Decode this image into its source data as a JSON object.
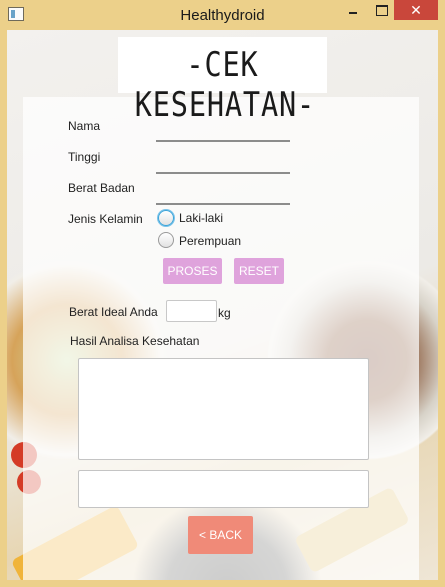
{
  "window": {
    "title": "Healthydroid",
    "close_symbol": "✕"
  },
  "logo": {
    "text": "-CEK KESEHATAN-"
  },
  "form": {
    "nama_label": "Nama",
    "tinggi_label": "Tinggi",
    "berat_label": "Berat Badan",
    "gender_label": "Jenis Kelamin",
    "gender_options": [
      "Laki-laki",
      "Perempuan"
    ],
    "nama_value": "",
    "tinggi_value": "",
    "berat_value": ""
  },
  "buttons": {
    "proses": "PROSES",
    "reset": "RESET",
    "back": "< BACK"
  },
  "result": {
    "ideal_label": "Berat Ideal Anda",
    "ideal_unit": "kg",
    "analysis_label": "Hasil Analisa Kesehatan",
    "ideal_value": "",
    "analysis_value": "",
    "extra_value": ""
  },
  "icons": {
    "app": "app-window-icon",
    "minimize": "minimize-icon",
    "maximize": "maximize-icon",
    "close": "close-icon"
  }
}
